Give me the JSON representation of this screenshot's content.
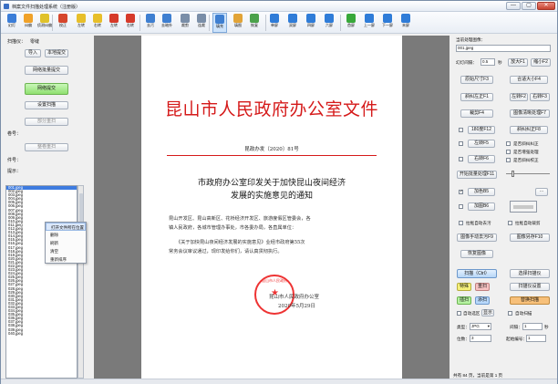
{
  "window": {
    "title": "档案文件扫描处理系统（注册版）",
    "min": "—",
    "max": "▢",
    "close": "✕"
  },
  "toolbar": {
    "items": [
      {
        "label": "幻灯",
        "icon": "slideshow-icon",
        "color": "#3b7dd8"
      },
      {
        "label": "纠偏",
        "icon": "deskew-icon",
        "color": "#f0a22a"
      },
      {
        "label": "侦测纠偏",
        "icon": "auto-deskew-icon",
        "color": "#e0c22a"
      },
      {
        "label": "校正",
        "icon": "correct-icon",
        "color": "#d6462d"
      },
      {
        "label": "左转",
        "icon": "rotate-left-icon",
        "color": "#e7bf2a"
      },
      {
        "label": "右转",
        "icon": "rotate-right-icon",
        "color": "#e7bf2a"
      },
      {
        "label": "左转",
        "icon": "turn-left-icon",
        "color": "#d63a2a"
      },
      {
        "label": "右转",
        "icon": "turn-right-icon",
        "color": "#d63a2a"
      },
      {
        "label": "去污",
        "icon": "despeckle-icon",
        "color": "#3e7fd1"
      },
      {
        "label": "去暗外",
        "icon": "remove-dark-edge-icon",
        "color": "#3e7fd1"
      },
      {
        "label": "裁剪",
        "icon": "crop-icon",
        "color": "#7a8ea8"
      },
      {
        "label": "连裁",
        "icon": "batch-crop-icon",
        "color": "#7a8ea8"
      },
      {
        "label": "填充",
        "icon": "fill-icon",
        "color": "#3e7fd1"
      },
      {
        "label": "填图",
        "icon": "fill-image-icon",
        "color": "#e2a437"
      },
      {
        "label": "恢复",
        "icon": "restore-icon",
        "color": "#4ba24b"
      },
      {
        "label": "单屏",
        "icon": "single-view-icon",
        "color": "#2f7cd8"
      },
      {
        "label": "双屏",
        "icon": "dual-view-icon",
        "color": "#2f7cd8"
      },
      {
        "label": "四屏",
        "icon": "quad-view-icon",
        "color": "#2f7cd8"
      },
      {
        "label": "六屏",
        "icon": "six-view-icon",
        "color": "#2f7cd8"
      },
      {
        "label": "首屏",
        "icon": "first-screen-icon",
        "color": "#38a83a"
      },
      {
        "label": "上一屏",
        "icon": "prev-screen-icon",
        "color": "#2f7cd8"
      },
      {
        "label": "下一屏",
        "icon": "next-screen-icon",
        "color": "#2f7cd8"
      },
      {
        "label": "末屏",
        "icon": "last-screen-icon",
        "color": "#2f7cd8"
      }
    ]
  },
  "left": {
    "scanner_label": "扫描仪：",
    "scanner_value": "零缝",
    "import": "导入",
    "local_scan": "本地提交",
    "batch_submit": "网络批量提交",
    "net_submit": "网络提交",
    "set_scan": "设置扫描",
    "partial_scan": "部分重扫",
    "volume_label": "卷号：",
    "rescan_volume": "整卷重扫",
    "file_no_label": "件号：",
    "hint_label": "提示："
  },
  "file_list": [
    "001.jpeg",
    "002.jpeg",
    "003.jpeg",
    "004.jpeg",
    "005.jpeg",
    "006.jpeg",
    "007.jpeg",
    "008.jpeg",
    "009.jpeg",
    "010.jpeg",
    "011.jpeg",
    "012.jpeg",
    "013.jpeg",
    "014.jpeg",
    "015.jpeg",
    "016.jpeg",
    "017.jpeg",
    "018.jpeg",
    "019.jpeg",
    "020.jpeg",
    "021.jpeg",
    "022.jpeg",
    "023.jpeg",
    "024.jpeg",
    "025.jpeg",
    "026.jpeg",
    "027.jpeg",
    "028.jpeg",
    "029.jpeg",
    "030.jpeg",
    "031.jpeg",
    "032.jpeg",
    "033.jpeg",
    "034.jpeg",
    "035.jpeg",
    "036.jpeg",
    "037.jpeg",
    "038.jpeg",
    "039.jpeg",
    "040.jpeg"
  ],
  "context_menu": [
    "打开文件所在位置",
    "删除",
    "刷新",
    "清空",
    "重新排序"
  ],
  "document": {
    "header": "昆山市人民政府办公室文件",
    "doc_number": "昆政办发〔2020〕81号",
    "title_line1": "市政府办公室印发关于加快昆山夜间经济",
    "title_line2": "发展的实施意见的通知",
    "body_lines": [
      "昆山开发区、昆山高新区、花桥经济开发区、旅游度假区管委会，各",
      "镇人民政府，各城市管理办事处，市各委办局，各直属单位：",
      "《关于加快昆山夜间经济发展的实施意见》业经市政府第55次",
      "常务会议审议通过，现印发给你们，请认真贯彻执行。"
    ],
    "issuer": "昆山市人民政府办公室",
    "date": "2020年5月29日",
    "seal_text": "昆山市人民政府"
  },
  "right": {
    "current_image_label": "当前处理图像：",
    "current_image": "001.jpeg",
    "slide_interval_label": "幻灯间隔：",
    "slide_interval_value": "0.5",
    "slide_unit": "秒",
    "zoom_in": "放大F1",
    "zoom_out": "缩小F2",
    "original_size": "原始尺寸F3",
    "fit_size": "合适大小F4",
    "deskew_left": "斜纠左正F1",
    "deskew_right": "左转F2",
    "rotate_right": "右转F3",
    "crop_f4": "裁剪F4",
    "image_sharpen": "图像清晰处理F7",
    "rotate180": "180度F12",
    "deskew_f8": "斜纠纠正F8",
    "left_turn": "左转F5",
    "right_turn": "右转F6",
    "whole_deskew": "是否斜纠纠正",
    "whole_enhance": "是否增强处理",
    "whole_rotate": "是否斜纠校正",
    "batch_process": "开始批量处理F11",
    "add_color": "加色B5",
    "add_image": "加图B6",
    "auto_orient": "拉框自动去污",
    "auto_crop": "拉框自动裁剪",
    "manual_despeckle": "图像手动去污F9",
    "image_save": "图像另存F10",
    "restore_image": "恢复图像",
    "scan_ctrl": "扫描（Ctrl）",
    "scan_setting": "选择扫描仪",
    "special": "特殊",
    "rescan": "重扫",
    "scan_settings": "扫描仪设置",
    "insert_scan": "插扫",
    "append_scan": "添扫",
    "replace_scan": "替换扫描",
    "auto_select": "自动选区",
    "show": "显示",
    "auto_scan": "自动扫描",
    "type_label": "类型：",
    "type_value": "JPG",
    "interval_label": "间隔：",
    "interval_value": "1",
    "interval_unit": "秒",
    "digits_label": "位数：",
    "digits_value": "3",
    "start_no_label": "起始编号：",
    "start_no_value": "1"
  },
  "status": {
    "text": "共有 84 页，当前是第 1 页"
  }
}
